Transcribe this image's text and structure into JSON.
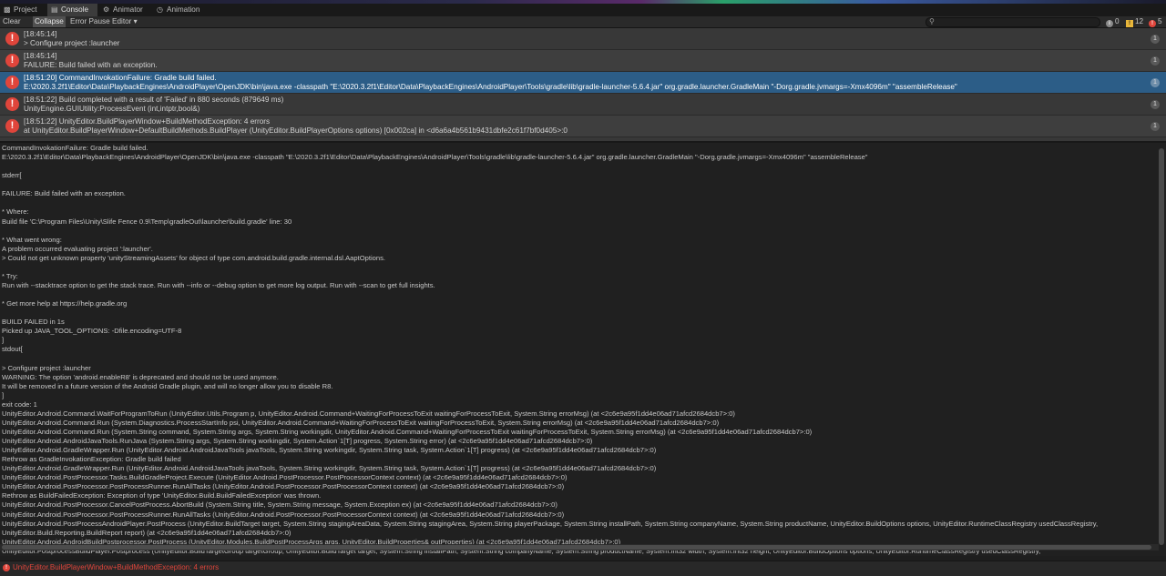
{
  "tabs": [
    {
      "label": "Project",
      "icon": "folder-icon"
    },
    {
      "label": "Console",
      "icon": "console-icon"
    },
    {
      "label": "Animator",
      "icon": "animator-icon"
    },
    {
      "label": "Animation",
      "icon": "animation-icon"
    }
  ],
  "toolbar": {
    "clear": "Clear",
    "collapse": "Collapse",
    "error_pause": "Error Pause",
    "editor": "Editor",
    "counts": {
      "info": "0",
      "warnings": "12",
      "errors": "5"
    }
  },
  "logs": [
    {
      "line1": "[18:45:14]",
      "line2": "> Configure project :launcher",
      "count": "1"
    },
    {
      "line1": "[18:45:14]",
      "line2": "FAILURE: Build failed with an exception.",
      "count": "1"
    },
    {
      "line1": "[18:51:20] CommandInvokationFailure: Gradle build failed.",
      "line2": "E:\\2020.3.2f1\\Editor\\Data\\PlaybackEngines\\AndroidPlayer\\OpenJDK\\bin\\java.exe -classpath \"E:\\2020.3.2f1\\Editor\\Data\\PlaybackEngines\\AndroidPlayer\\Tools\\gradle\\lib\\gradle-launcher-5.6.4.jar\" org.gradle.launcher.GradleMain \"-Dorg.gradle.jvmargs=-Xmx4096m\" \"assembleRelease\"",
      "count": "1"
    },
    {
      "line1": "[18:51:22] Build completed with a result of 'Failed' in 880 seconds (879649 ms)",
      "line2": "UnityEngine.GUIUtility:ProcessEvent (int,intptr,bool&)",
      "count": "1"
    },
    {
      "line1": "[18:51:22] UnityEditor.BuildPlayerWindow+BuildMethodException: 4 errors",
      "line2": "  at UnityEditor.BuildPlayerWindow+DefaultBuildMethods.BuildPlayer (UnityEditor.BuildPlayerOptions options) [0x002ca] in <d6a6a4b561b9431dbfe2c61f7bf0d405>:0",
      "count": "1"
    }
  ],
  "detail": "CommandInvokationFailure: Gradle build failed.\nE:\\2020.3.2f1\\Editor\\Data\\PlaybackEngines\\AndroidPlayer\\OpenJDK\\bin\\java.exe -classpath \"E:\\2020.3.2f1\\Editor\\Data\\PlaybackEngines\\AndroidPlayer\\Tools\\gradle\\lib\\gradle-launcher-5.6.4.jar\" org.gradle.launcher.GradleMain \"-Dorg.gradle.jvmargs=-Xmx4096m\" \"assembleRelease\"\n\nstderr[\n\nFAILURE: Build failed with an exception.\n\n* Where:\nBuild file 'C:\\Program Files\\Unity\\Slife Fence 0.9\\Temp\\gradleOut\\launcher\\build.gradle' line: 30\n\n* What went wrong:\nA problem occurred evaluating project ':launcher'.\n> Could not get unknown property 'unityStreamingAssets' for object of type com.android.build.gradle.internal.dsl.AaptOptions.\n\n* Try:\nRun with --stacktrace option to get the stack trace. Run with --info or --debug option to get more log output. Run with --scan to get full insights.\n\n* Get more help at https://help.gradle.org\n\nBUILD FAILED in 1s\nPicked up JAVA_TOOL_OPTIONS: -Dfile.encoding=UTF-8\n]\nstdout[\n\n> Configure project :launcher\nWARNING: The option 'android.enableR8' is deprecated and should not be used anymore.\nIt will be removed in a future version of the Android Gradle plugin, and will no longer allow you to disable R8.\n]\nexit code: 1\nUnityEditor.Android.Command.WaitForProgramToRun (UnityEditor.Utils.Program p, UnityEditor.Android.Command+WaitingForProcessToExit waitingForProcessToExit, System.String errorMsg) (at <2c6e9a95f1dd4e06ad71afcd2684dcb7>:0)\nUnityEditor.Android.Command.Run (System.Diagnostics.ProcessStartInfo psi, UnityEditor.Android.Command+WaitingForProcessToExit waitingForProcessToExit, System.String errorMsg) (at <2c6e9a95f1dd4e06ad71afcd2684dcb7>:0)\nUnityEditor.Android.Command.Run (System.String command, System.String args, System.String workingdir, UnityEditor.Android.Command+WaitingForProcessToExit waitingForProcessToExit, System.String errorMsg) (at <2c6e9a95f1dd4e06ad71afcd2684dcb7>:0)\nUnityEditor.Android.AndroidJavaTools.RunJava (System.String args, System.String workingdir, System.Action`1[T] progress, System.String error) (at <2c6e9a95f1dd4e06ad71afcd2684dcb7>:0)\nUnityEditor.Android.GradleWrapper.Run (UnityEditor.Android.AndroidJavaTools javaTools, System.String workingdir, System.String task, System.Action`1[T] progress) (at <2c6e9a95f1dd4e06ad71afcd2684dcb7>:0)\nRethrow as GradleInvokationException: Gradle build failed\nUnityEditor.Android.GradleWrapper.Run (UnityEditor.Android.AndroidJavaTools javaTools, System.String workingdir, System.String task, System.Action`1[T] progress) (at <2c6e9a95f1dd4e06ad71afcd2684dcb7>:0)\nUnityEditor.Android.PostProcessor.Tasks.BuildGradleProject.Execute (UnityEditor.Android.PostProcessor.PostProcessorContext context) (at <2c6e9a95f1dd4e06ad71afcd2684dcb7>:0)\nUnityEditor.Android.PostProcessor.PostProcessRunner.RunAllTasks (UnityEditor.Android.PostProcessor.PostProcessorContext context) (at <2c6e9a95f1dd4e06ad71afcd2684dcb7>:0)\nRethrow as BuildFailedException: Exception of type 'UnityEditor.Build.BuildFailedException' was thrown.\nUnityEditor.Android.PostProcessor.CancelPostProcess.AbortBuild (System.String title, System.String message, System.Exception ex) (at <2c6e9a95f1dd4e06ad71afcd2684dcb7>:0)\nUnityEditor.Android.PostProcessor.PostProcessRunner.RunAllTasks (UnityEditor.Android.PostProcessor.PostProcessorContext context) (at <2c6e9a95f1dd4e06ad71afcd2684dcb7>:0)\nUnityEditor.Android.PostProcessAndroidPlayer.PostProcess (UnityEditor.BuildTarget target, System.String stagingAreaData, System.String stagingArea, System.String playerPackage, System.String installPath, System.String companyName, System.String productName, UnityEditor.BuildOptions options, UnityEditor.RuntimeClassRegistry usedClassRegistry, UnityEditor.Build.Reporting.BuildReport report) (at <2c6e9a95f1dd4e06ad71afcd2684dcb7>:0)\nUnityEditor.Android.AndroidBuildPostprocessor.PostProcess (UnityEditor.Modules.BuildPostProcessArgs args, UnityEditor.BuildProperties& outProperties) (at <2c6e9a95f1dd4e06ad71afcd2684dcb7>:0)\nUnityEditor.PostprocessBuildPlayer.Postprocess (UnityEditor.BuildTargetGroup targetGroup, UnityEditor.BuildTarget target, System.String installPath, System.String companyName, System.String productName, System.Int32 width, System.Int32 height, UnityEditor.BuildOptions options, UnityEditor.RuntimeClassRegistry usedClassRegistry, UnityEditor.Build.Reporting.BuildReport report) (at <d6a6a4b561b9431dbfe2c61f7bf0d405>:0)\nUnityEngine.GUIUtility:ProcessEvent(Int32, IntPtr, Boolean&)",
  "status": {
    "text": "UnityEditor.BuildPlayerWindow+BuildMethodException: 4 errors"
  },
  "colors": {
    "error": "#e0453b",
    "selection": "#2c5d87",
    "warning": "#e8b63a"
  }
}
